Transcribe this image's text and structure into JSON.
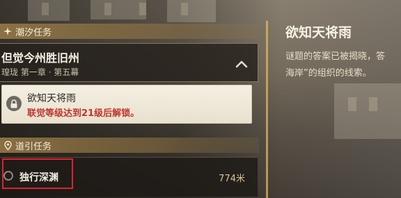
{
  "sections": {
    "tide": {
      "label": "潮汐任务",
      "icon": "star-icon"
    },
    "guide": {
      "label": "道引任务",
      "icon": "location-pin-icon"
    }
  },
  "main_quest": {
    "title": "但觉今州胜旧州",
    "chapter": "瑝珑 第一章 · 第五幕",
    "toggle_icon": "chevron-up-icon"
  },
  "locked_quest": {
    "name": "欲知天将雨",
    "requirement": "联觉等级达到21级后解锁。",
    "icon": "lock-icon"
  },
  "guide_quest": {
    "name": "独行深渊",
    "distance": "774米"
  },
  "detail": {
    "title": "欲知天将雨",
    "desc_line1": "谜题的答案已被揭晓，答",
    "desc_line2": "海岸”的组织的线索。"
  },
  "colors": {
    "accent_gold": "#c9a75e",
    "locked_red": "#c0352b",
    "highlight_red": "#e0222a"
  }
}
